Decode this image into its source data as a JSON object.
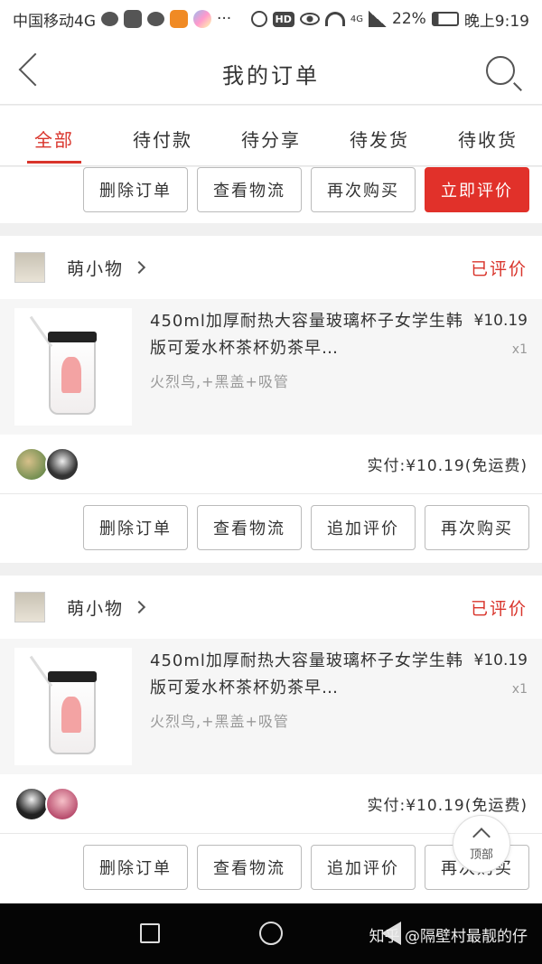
{
  "status_bar": {
    "carrier": "中国移动4G",
    "battery": "22%",
    "time": "晚上9:19",
    "network": "4G",
    "hd": "HD"
  },
  "nav": {
    "title": "我的订单"
  },
  "tabs": [
    {
      "label": "全部"
    },
    {
      "label": "待付款"
    },
    {
      "label": "待分享"
    },
    {
      "label": "待发货"
    },
    {
      "label": "待收货"
    }
  ],
  "top_actions": {
    "delete": "删除订单",
    "logistics": "查看物流",
    "rebuy": "再次购买",
    "review_now": "立即评价"
  },
  "orders": [
    {
      "shop_name": "萌小物",
      "status": "已评价",
      "product_name": "450ml加厚耐热大容量玻璃杯子女学生韩版可爱水杯茶杯奶茶早…",
      "spec": "火烈鸟,+黑盖+吸管",
      "price": "¥10.19",
      "qty": "x1",
      "paid": "实付:¥10.19(免运费)",
      "actions": {
        "delete": "删除订单",
        "logistics": "查看物流",
        "add_review": "追加评价",
        "rebuy": "再次购买"
      }
    },
    {
      "shop_name": "萌小物",
      "status": "已评价",
      "product_name": "450ml加厚耐热大容量玻璃杯子女学生韩版可爱水杯茶杯奶茶早…",
      "spec": "火烈鸟,+黑盖+吸管",
      "price": "¥10.19",
      "qty": "x1",
      "paid": "实付:¥10.19(免运费)",
      "actions": {
        "delete": "删除订单",
        "logistics": "查看物流",
        "add_review": "追加评价",
        "rebuy": "再次购买"
      }
    }
  ],
  "top_button": {
    "label": "顶部"
  },
  "watermark": "知乎 @隔壁村最靓的仔",
  "colors": {
    "accent": "#e1312a",
    "status_red": "#d9342b"
  }
}
